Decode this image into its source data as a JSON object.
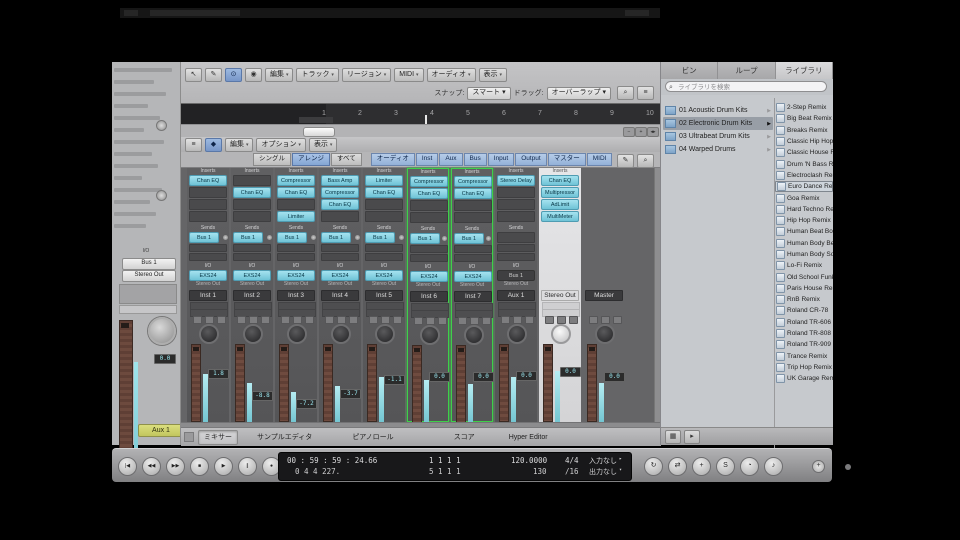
{
  "inspector": {
    "io_label": "I/O",
    "send_button": "Bus 1",
    "output_button": "Stereo Out",
    "fader_value": "0.0",
    "track_pill": "Aux 1"
  },
  "arrange": {
    "icon_names": [
      "pointer-icon",
      "pencil-icon",
      "catch-icon",
      "midi-icon"
    ],
    "icons": [
      "↖",
      "✎",
      "⊙",
      "◉"
    ],
    "menus": [
      "編集",
      "トラック",
      "リージョン",
      "MIDI",
      "オーディオ",
      "表示"
    ],
    "snap_label": "スナップ:",
    "snap_value": "スマート",
    "drag_label": "ドラッグ:",
    "drag_value": "オーバーラップ",
    "right_icons": [
      "⌕",
      "≡"
    ],
    "ruler_numbers": [
      "1",
      "2",
      "3",
      "4",
      "5",
      "6",
      "7",
      "8",
      "9",
      "10"
    ]
  },
  "mixer": {
    "icons": [
      "≡",
      "◆"
    ],
    "menus": [
      "編集",
      "オプション",
      "表示"
    ],
    "view_buttons": [
      "シングル",
      "アレンジ",
      "すべて"
    ],
    "active_view": "アレンジ",
    "filter_buttons": [
      "オーディオ",
      "Inst",
      "Aux",
      "Bus",
      "Input",
      "Output",
      "マスター",
      "MIDI"
    ],
    "right_icons": [
      "✎",
      "⌕"
    ],
    "strip_labels": {
      "inserts": "Inserts",
      "sends": "Sends",
      "io": "I/O"
    },
    "channels": [
      {
        "name": "Inst 1",
        "type": "inst",
        "inserts": [
          "Chan EQ",
          "",
          "",
          ""
        ],
        "send": "Bus 1",
        "instrument": "EXS24",
        "output": "Stereo Out",
        "value": "1.8",
        "meter": 0.62,
        "chip": 0.32,
        "selected": false
      },
      {
        "name": "Inst 2",
        "type": "inst",
        "inserts": [
          "",
          "Chan EQ",
          "",
          ""
        ],
        "send": "Bus 1",
        "instrument": "EXS24",
        "output": "Stereo Out",
        "value": "-8.8",
        "meter": 0.5,
        "chip": 0.6,
        "selected": false
      },
      {
        "name": "Inst 3",
        "type": "inst",
        "inserts": [
          "Compressor",
          "Chan EQ",
          "",
          "Limiter"
        ],
        "send": "Bus 1",
        "instrument": "EXS24",
        "output": "Stereo Out",
        "value": "-7.2",
        "meter": 0.38,
        "chip": 0.7,
        "selected": false
      },
      {
        "name": "Inst 4",
        "type": "inst",
        "inserts": [
          "Bass Amp",
          "Compressor",
          "Chan EQ",
          ""
        ],
        "send": "Bus 1",
        "instrument": "EXS24",
        "output": "Stereo Out",
        "value": "-3.7",
        "meter": 0.46,
        "chip": 0.58,
        "selected": false
      },
      {
        "name": "Inst 5",
        "type": "inst",
        "inserts": [
          "Limiter",
          "Chan EQ",
          "",
          ""
        ],
        "send": "Bus 1",
        "instrument": "EXS24",
        "output": "Stereo Out",
        "value": "-1.1",
        "meter": 0.58,
        "chip": 0.4,
        "selected": false
      },
      {
        "name": "Inst 6",
        "type": "inst",
        "inserts": [
          "Compressor",
          "Chan EQ",
          "",
          ""
        ],
        "send": "Bus 1",
        "instrument": "EXS24",
        "output": "Stereo Out",
        "value": "0.0",
        "meter": 0.55,
        "chip": 0.34,
        "selected": true
      },
      {
        "name": "Inst 7",
        "type": "inst",
        "inserts": [
          "Compressor",
          "Chan EQ",
          "",
          ""
        ],
        "send": "Bus 1",
        "instrument": "EXS24",
        "output": "Stereo Out",
        "value": "0.0",
        "meter": 0.5,
        "chip": 0.34,
        "selected": true
      },
      {
        "name": "Aux 1",
        "type": "aux",
        "inserts": [
          "Stereo Delay",
          "",
          "",
          ""
        ],
        "send": "",
        "instrument": "Bus 1",
        "output": "Stereo Out",
        "value": "0.0",
        "meter": 0.58,
        "chip": 0.34,
        "selected": false
      },
      {
        "name": "Stereo Out",
        "type": "output",
        "inserts": [
          "Chan EQ",
          "Multipressor",
          "AdLimit",
          "MultiMeter"
        ],
        "send": "",
        "instrument": "",
        "output": "",
        "value": "0.0",
        "meter": 0.66,
        "chip": 0.3,
        "selected": false
      },
      {
        "name": "Master",
        "type": "master",
        "inserts": [
          "",
          "",
          "",
          ""
        ],
        "send": "",
        "instrument": "",
        "output": "",
        "value": "0.0",
        "meter": 0.5,
        "chip": 0.36,
        "selected": false
      }
    ],
    "tabs": [
      "ミキサー",
      "サンプルエディタ",
      "ピアノロール",
      "スコア",
      "Hyper Editor"
    ],
    "active_tab": "ミキサー"
  },
  "media": {
    "tabs": [
      "ビン",
      "ループ",
      "ライブラリ"
    ],
    "active_tab": "ライブラリ",
    "search_placeholder": "ライブラリを検索",
    "categories": [
      "01 Acoustic Drum Kits",
      "02 Electronic Drum Kits",
      "03 Ultrabeat Drum Kits",
      "04 Warped Drums"
    ],
    "selected_category": "02 Electronic Drum Kits",
    "patches": [
      "2-Step Remix",
      "Big Beat Remix",
      "Breaks Remix",
      "Classic Hip Hop Remix",
      "Classic House Remix",
      "Drum 'N Bass Remix",
      "Electroclash Remix",
      "Euro Dance Remix",
      "Goa Remix",
      "Hard Techno Remix",
      "Hip Hop Remix",
      "Human Beat Box",
      "Human Body Beats",
      "Human Body Sounds",
      "Lo-Fi Remix",
      "Old School Funk Remix",
      "Paris House Remix",
      "RnB Remix",
      "Roland CR-78",
      "Roland TR-606",
      "Roland TR-808",
      "Roland TR-909",
      "Trance Remix",
      "Trip Hop Remix",
      "UK Garage Remix"
    ],
    "selected_patch": "Euro Dance Remix",
    "footer_icons": [
      "▦",
      "▸"
    ]
  },
  "transport": {
    "buttons_left": [
      "|◀",
      "◀◀",
      "▶▶",
      "■",
      "▶",
      "∥",
      "●"
    ],
    "buttons_left_names": [
      "go-to-begin-button",
      "rewind-button",
      "forward-button",
      "stop-button",
      "play-button",
      "pause-button",
      "record-button"
    ],
    "buttons_right": [
      "↻",
      "⇄",
      "+",
      "S",
      "◔",
      "♪"
    ],
    "buttons_right_names": [
      "cycle-button",
      "autopunch-button",
      "replace-button",
      "solo-button",
      "sync-button",
      "metronome-button"
    ],
    "lcd": {
      "timecode": "00 : 59 : 59 : 24.66",
      "position": "0   4   4  227.",
      "locators_top": "1    1    1    1",
      "locators_bottom": "5    1    1    1",
      "tempo": "120.0000",
      "tempo_alt": "130",
      "signature": "4/4",
      "division": "/16",
      "midi_in": "入力なし",
      "midi_out": "出力なし"
    }
  }
}
